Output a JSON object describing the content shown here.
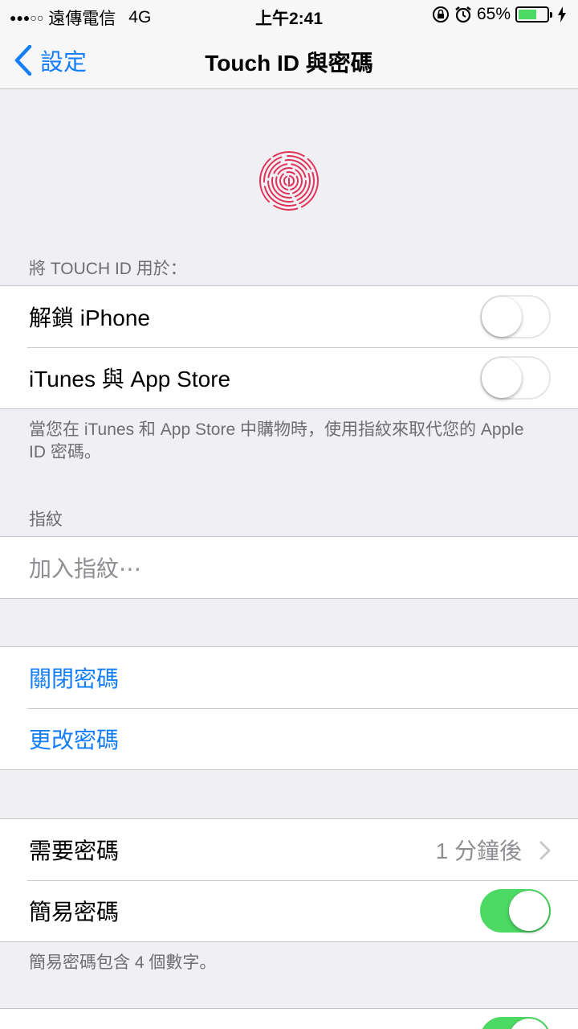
{
  "status_bar": {
    "signal_dots": "●●●○○",
    "carrier": "遠傳電信",
    "network": "4G",
    "time": "上午2:41",
    "battery_percent": "65%",
    "battery_level": 0.65,
    "accent": "#4cd964"
  },
  "nav": {
    "back_label": "設定",
    "title": "Touch ID 與密碼",
    "tint": "#157efb"
  },
  "touch_id_section": {
    "header": "將 TOUCH ID 用於：",
    "rows": [
      {
        "label": "解鎖 iPhone",
        "on": false
      },
      {
        "label": "iTunes 與 App Store",
        "on": false
      }
    ],
    "footer": "當您在 iTunes 和 App Store 中購物時，使用指紋來取代您的 Apple ID 密碼。"
  },
  "fingerprint_section": {
    "header": "指紋",
    "add_label": "加入指紋⋯"
  },
  "passcode_section": {
    "turn_off_label": "關閉密碼",
    "change_label": "更改密碼"
  },
  "require_section": {
    "require_label": "需要密碼",
    "require_value": "1 分鐘後",
    "simple_label": "簡易密碼",
    "simple_on": true,
    "footer": "簡易密碼包含 4 個數字。"
  },
  "icons": [
    "lock-rotation-icon",
    "alarm-icon",
    "charging-bolt-icon",
    "back-chevron-icon",
    "fingerprint-icon",
    "chevron-right-icon"
  ]
}
